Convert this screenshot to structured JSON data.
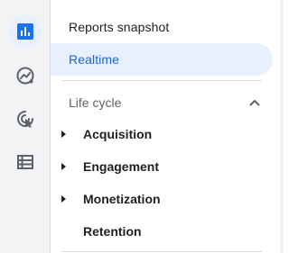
{
  "rail": {
    "items": [
      {
        "icon": "reports-icon",
        "active": true
      },
      {
        "icon": "explore-icon",
        "active": false
      },
      {
        "icon": "advertising-icon",
        "active": false
      },
      {
        "icon": "configure-list-icon",
        "active": false
      }
    ],
    "accent_color": "#1a73e8"
  },
  "nav": {
    "reports_snapshot": "Reports snapshot",
    "realtime": "Realtime"
  },
  "lifecycle": {
    "title": "Life cycle",
    "expanded": true,
    "items": [
      {
        "label": "Acquisition",
        "has_children": true
      },
      {
        "label": "Engagement",
        "has_children": true
      },
      {
        "label": "Monetization",
        "has_children": true
      },
      {
        "label": "Retention",
        "has_children": false
      }
    ]
  },
  "colors": {
    "selected_bg": "#e8f0fe",
    "selected_text": "#1967d2",
    "rail_bg": "#f1f3f4"
  }
}
